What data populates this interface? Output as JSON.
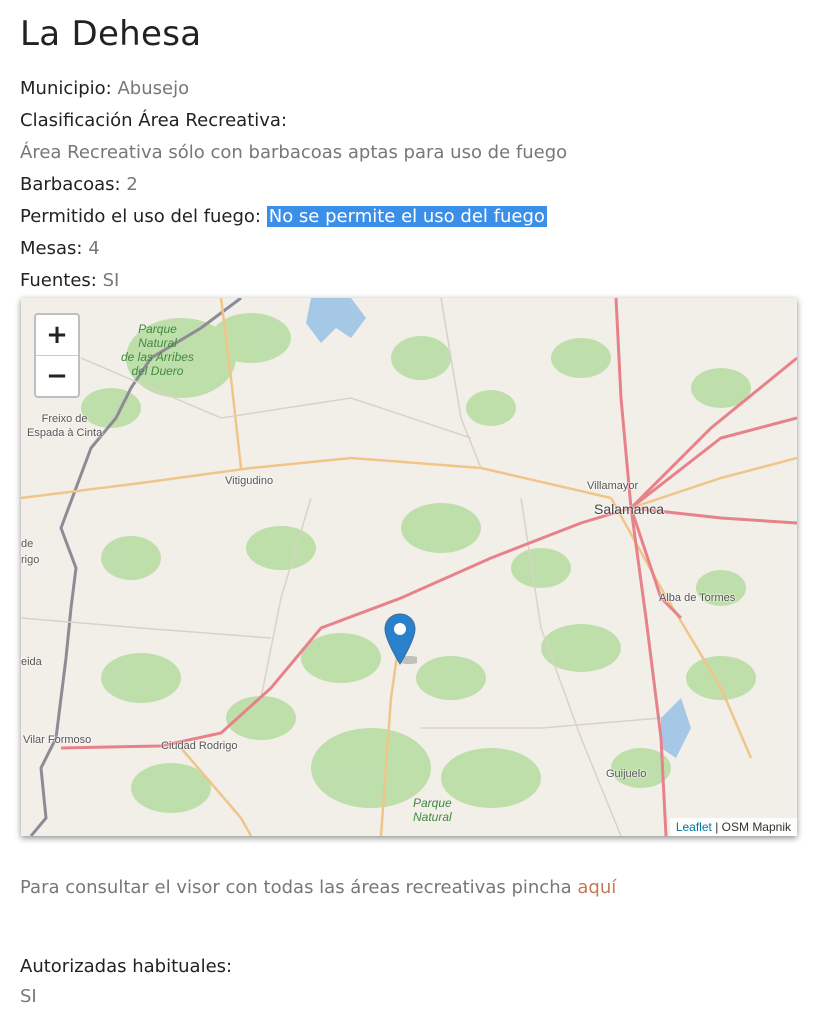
{
  "page": {
    "title": "La Dehesa",
    "municipio_label": "Municipio:",
    "municipio_value": "Abusejo",
    "clasificacion_label": "Clasificación Área Recreativa:",
    "clasificacion_value": "Área Recreativa sólo con barbacoas aptas para uso de fuego",
    "barbacoas_label": "Barbacoas:",
    "barbacoas_value": "2",
    "fuego_label": "Permitido el uso del fuego:",
    "fuego_value": "No se permite el uso del fuego",
    "mesas_label": "Mesas:",
    "mesas_value": "4",
    "fuentes_label": "Fuentes:",
    "fuentes_value": "SI"
  },
  "map": {
    "zoom_in": "+",
    "zoom_out": "−",
    "places": {
      "freixo": "Freixo de\nEspada à Cinta",
      "vitigudino": "Vitigudino",
      "villamayor": "Villamayor",
      "salamanca": "Salamanca",
      "alba": "Alba de Tormes",
      "ciudad_rodrigo": "Ciudad Rodrigo",
      "vilar_formoso": "Vilar Formoso",
      "guijuelo": "Guijuelo",
      "edge_de": "de",
      "edge_rigo": "rigo",
      "edge_eida": "eida"
    },
    "parks": {
      "arribes": "Parque\nNatural\nde las Arribes\ndel Duero",
      "south": "Parque\nNatural"
    },
    "attribution_link": "Leaflet",
    "attribution_text": " | OSM Mapnik",
    "colors": {
      "background": "#f2efe9",
      "forest": "#b5dca0",
      "water": "#a5c8e6",
      "road_main": "#e8828a",
      "road_secondary": "#f0c58a",
      "border": "#8e8a96",
      "marker": "#2a81cb"
    },
    "marker_icon": "map-pin-icon"
  },
  "footer": {
    "note_text": "Para consultar el visor con todas las áreas recreativas pincha ",
    "note_link": "aquí",
    "autorizadas_label": "Autorizadas habituales:",
    "autorizadas_value": "SI"
  }
}
